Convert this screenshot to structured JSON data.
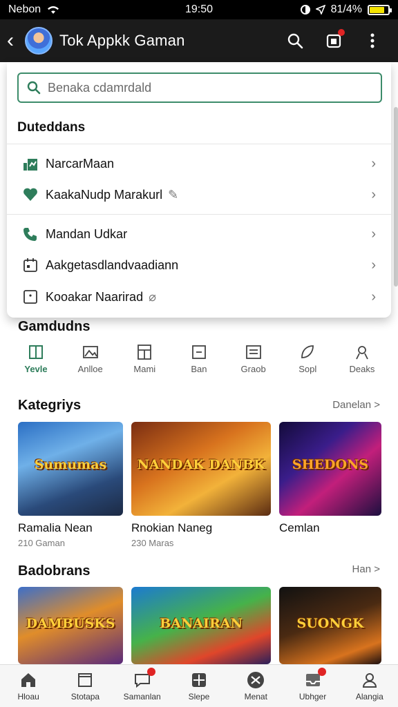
{
  "status_bar": {
    "carrier": "Nebon",
    "time": "19:50",
    "battery": "81/4%",
    "battery_level": 0.81
  },
  "app_bar": {
    "title": "Tok Appkk Gaman"
  },
  "search": {
    "placeholder": "Benaka cdamrdald"
  },
  "dropdown": {
    "heading": "Duteddans",
    "items": [
      {
        "label": "NarcarMaan",
        "icon": "chart-icon"
      },
      {
        "label": "KaakaNudp Marakurl",
        "icon": "heart-icon"
      },
      {
        "label": "Mandan Udkar",
        "icon": "phone-icon"
      },
      {
        "label": "Aakgetasdlandvaadiann",
        "icon": "calendar-icon"
      },
      {
        "label": "Kooakar Naarirad",
        "icon": "square-icon"
      }
    ]
  },
  "categories_section": {
    "title": "Gamdudns",
    "items": [
      {
        "label": "Yevle",
        "active": true
      },
      {
        "label": "Anlloe"
      },
      {
        "label": "Mami"
      },
      {
        "label": "Ban"
      },
      {
        "label": "Graob"
      },
      {
        "label": "Sopl"
      },
      {
        "label": "Deaks"
      }
    ]
  },
  "kategriys": {
    "title": "Kategriys",
    "more": "Danelan >",
    "cards": [
      {
        "logo": "Sumumas",
        "name": "Ramalia Nean",
        "sub": "210 Gaman"
      },
      {
        "logo": "NANDAK DANBK",
        "name": "Rnokian Naneg",
        "sub": "230 Maras"
      },
      {
        "logo": "SHEDONS",
        "name": "Cemlan",
        "sub": ""
      }
    ]
  },
  "badobrans": {
    "title": "Badobrans",
    "more": "Han >",
    "cards": [
      {
        "logo": "DAMBUSKS"
      },
      {
        "logo": "BANAIRAN"
      },
      {
        "logo": "SUONGK"
      }
    ]
  },
  "bottom_nav": [
    {
      "label": "Hloau",
      "icon": "home-icon"
    },
    {
      "label": "Stotapa",
      "icon": "bookmark-icon"
    },
    {
      "label": "Samanlan",
      "icon": "chat-icon",
      "badge": true
    },
    {
      "label": "Slepe",
      "icon": "grid-icon"
    },
    {
      "label": "Menat",
      "icon": "tools-icon"
    },
    {
      "label": "Ubhger",
      "icon": "inbox-icon",
      "badge": true
    },
    {
      "label": "Alangia",
      "icon": "user-icon"
    }
  ]
}
